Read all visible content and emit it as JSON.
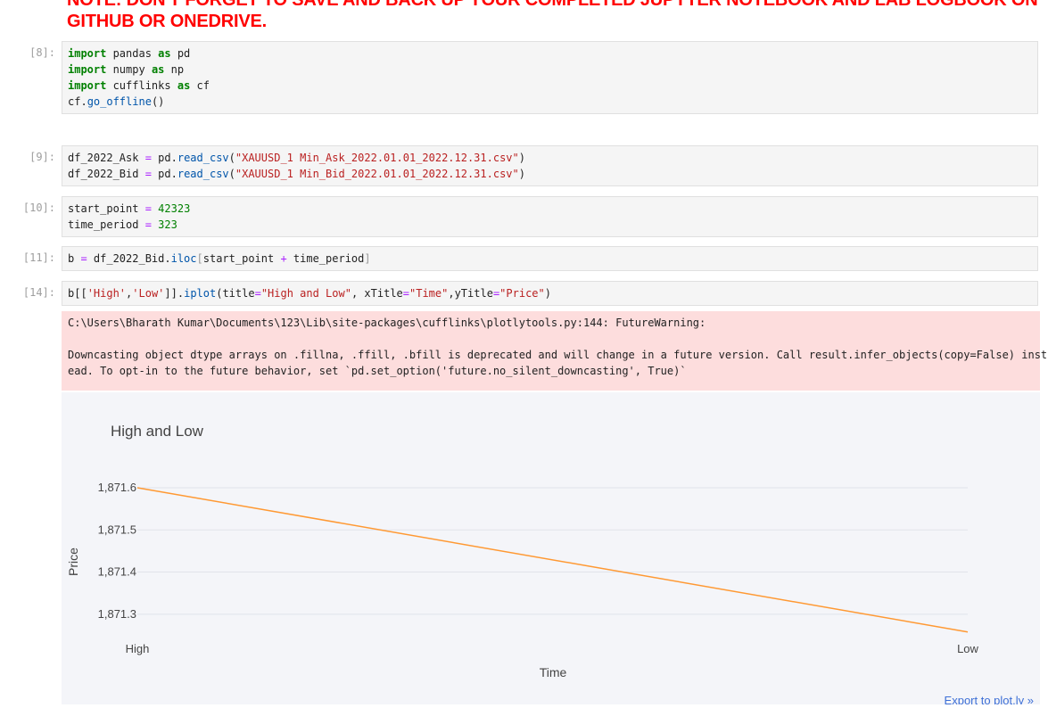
{
  "note": {
    "line1": "NOTE: DON'T FORGET TO SAVE AND BACK UP YOUR COMPLETED JUPYTER NOTEBOOK AND LAB LOGBOOK ON",
    "line2": "GITHUB OR ONEDRIVE."
  },
  "cells": [
    {
      "prompt": "[8]:",
      "lines": [
        [
          {
            "t": "import",
            "k": "kw"
          },
          {
            "t": " pandas ",
            "k": ""
          },
          {
            "t": "as",
            "k": "kw"
          },
          {
            "t": " pd",
            "k": ""
          }
        ],
        [
          {
            "t": "import",
            "k": "kw"
          },
          {
            "t": " numpy ",
            "k": ""
          },
          {
            "t": "as",
            "k": "kw"
          },
          {
            "t": " np",
            "k": ""
          }
        ],
        [
          {
            "t": "import",
            "k": "kw"
          },
          {
            "t": " cufflinks ",
            "k": ""
          },
          {
            "t": "as",
            "k": "kw"
          },
          {
            "t": " cf",
            "k": ""
          }
        ],
        [
          {
            "t": "cf.",
            "k": ""
          },
          {
            "t": "go_offline",
            "k": "fn"
          },
          {
            "t": "()",
            "k": ""
          }
        ]
      ]
    },
    {
      "prompt": "[9]:",
      "lines": [
        [
          {
            "t": "df_2022_Ask ",
            "k": ""
          },
          {
            "t": "=",
            "k": "op"
          },
          {
            "t": " pd.",
            "k": ""
          },
          {
            "t": "read_csv",
            "k": "fn"
          },
          {
            "t": "(",
            "k": ""
          },
          {
            "t": "\"XAUUSD_1 Min_Ask_2022.01.01_2022.12.31.csv\"",
            "k": "str"
          },
          {
            "t": ")",
            "k": ""
          }
        ],
        [
          {
            "t": "df_2022_Bid ",
            "k": ""
          },
          {
            "t": "=",
            "k": "op"
          },
          {
            "t": " pd.",
            "k": ""
          },
          {
            "t": "read_csv",
            "k": "fn"
          },
          {
            "t": "(",
            "k": ""
          },
          {
            "t": "\"XAUUSD_1 Min_Bid_2022.01.01_2022.12.31.csv\"",
            "k": "str"
          },
          {
            "t": ")",
            "k": ""
          }
        ]
      ]
    },
    {
      "prompt": "[10]:",
      "lines": [
        [
          {
            "t": "start_point ",
            "k": ""
          },
          {
            "t": "=",
            "k": "op"
          },
          {
            "t": " ",
            "k": ""
          },
          {
            "t": "42323",
            "k": "num"
          }
        ],
        [
          {
            "t": "time_period ",
            "k": ""
          },
          {
            "t": "=",
            "k": "op"
          },
          {
            "t": " ",
            "k": ""
          },
          {
            "t": "323",
            "k": "num"
          }
        ]
      ]
    },
    {
      "prompt": "[11]:",
      "lines": [
        [
          {
            "t": "b ",
            "k": ""
          },
          {
            "t": "=",
            "k": "op"
          },
          {
            "t": " df_2022_Bid.",
            "k": ""
          },
          {
            "t": "iloc",
            "k": "fn"
          },
          {
            "t": "[",
            "k": "br"
          },
          {
            "t": "start_point ",
            "k": ""
          },
          {
            "t": "+",
            "k": "op"
          },
          {
            "t": " time_period",
            "k": ""
          },
          {
            "t": "]",
            "k": "br"
          }
        ]
      ]
    },
    {
      "prompt": "[14]:",
      "lines": [
        [
          {
            "t": "b[[",
            "k": ""
          },
          {
            "t": "'High'",
            "k": "str"
          },
          {
            "t": ",",
            "k": ""
          },
          {
            "t": "'Low'",
            "k": "str"
          },
          {
            "t": "]].",
            "k": ""
          },
          {
            "t": "iplot",
            "k": "fn"
          },
          {
            "t": "(title",
            "k": ""
          },
          {
            "t": "=",
            "k": "op"
          },
          {
            "t": "\"High and Low\"",
            "k": "str"
          },
          {
            "t": ", xTitle",
            "k": ""
          },
          {
            "t": "=",
            "k": "op"
          },
          {
            "t": "\"Time\"",
            "k": "str"
          },
          {
            "t": ",yTitle",
            "k": ""
          },
          {
            "t": "=",
            "k": "op"
          },
          {
            "t": "\"Price\"",
            "k": "str"
          },
          {
            "t": ")",
            "k": ""
          }
        ]
      ]
    }
  ],
  "stderr": {
    "line1": "C:\\Users\\Bharath Kumar\\Documents\\123\\Lib\\site-packages\\cufflinks\\plotlytools.py:144: FutureWarning:",
    "line2": "Downcasting object dtype arrays on .fillna, .ffill, .bfill is deprecated and will change in a future version. Call result.infer_objects(copy=False) inst",
    "line3": "ead. To opt-in to the future behavior, set `pd.set_option('future.no_silent_downcasting', True)`"
  },
  "chart_data": {
    "type": "line",
    "title": "High and Low",
    "xlabel": "Time",
    "ylabel": "Price",
    "categories": [
      "High",
      "Low"
    ],
    "values": [
      1871.6,
      1871.258
    ],
    "yticks": [
      "1,871.6",
      "1,871.5",
      "1,871.4",
      "1,871.3"
    ],
    "ytick_values": [
      1871.6,
      1871.5,
      1871.4,
      1871.3
    ],
    "ylim": [
      1871.213,
      1871.657
    ],
    "grid": true,
    "line_color": "#ff9933"
  },
  "export_link": "Export to plot.ly »"
}
